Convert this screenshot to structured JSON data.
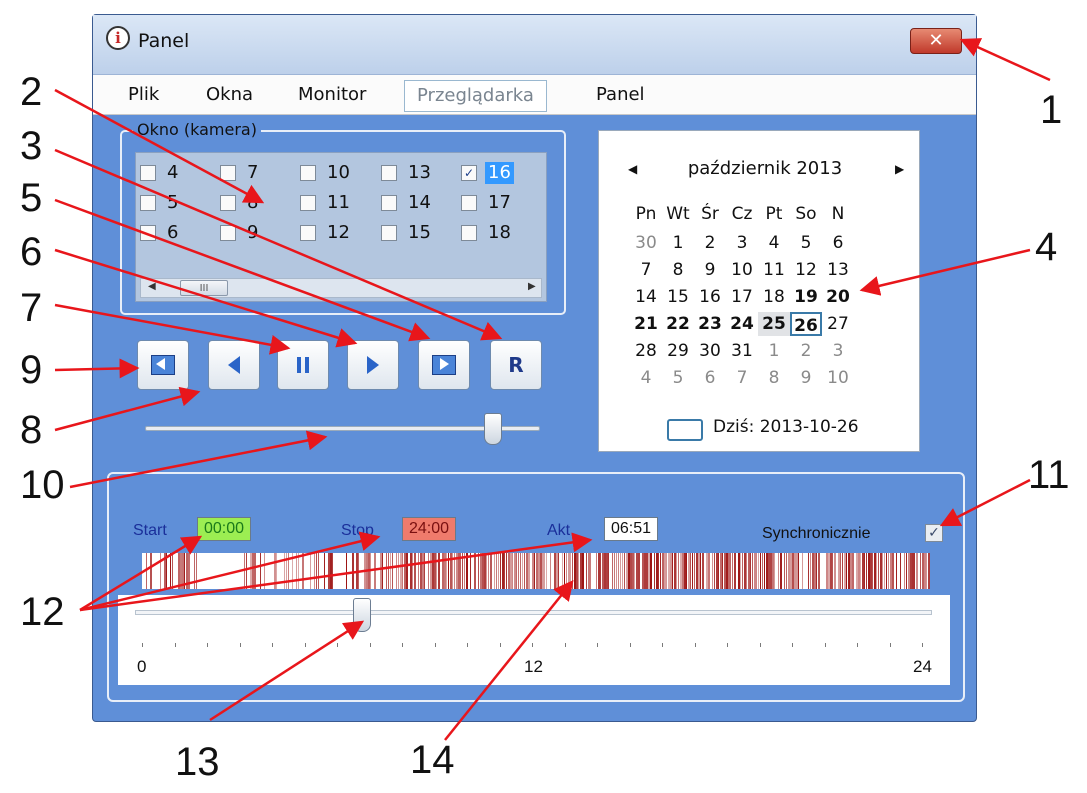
{
  "window": {
    "title": "Panel",
    "close_glyph": "✕"
  },
  "menu": [
    "Plik",
    "Okna",
    "Monitor",
    "Przeglądarka",
    "Panel"
  ],
  "camera_group": {
    "label": "Okno (kamera)",
    "items": [
      {
        "num": "4",
        "checked": false
      },
      {
        "num": "5",
        "checked": false
      },
      {
        "num": "6",
        "checked": false
      },
      {
        "num": "7",
        "checked": false
      },
      {
        "num": "8",
        "checked": false
      },
      {
        "num": "9",
        "checked": false
      },
      {
        "num": "10",
        "checked": false
      },
      {
        "num": "11",
        "checked": false
      },
      {
        "num": "12",
        "checked": false
      },
      {
        "num": "13",
        "checked": false
      },
      {
        "num": "14",
        "checked": false
      },
      {
        "num": "15",
        "checked": false
      },
      {
        "num": "16",
        "checked": true,
        "selected": true
      },
      {
        "num": "17",
        "checked": false
      },
      {
        "num": "18",
        "checked": false
      }
    ],
    "scroll_left": "◀",
    "scroll_right": "▶",
    "scroll_thumb": "III"
  },
  "playback": {
    "reset_label": "R",
    "speed_level": 0.88
  },
  "calendar": {
    "month_label": "październik 2013",
    "prev": "◀",
    "next": "▶",
    "weekdays": [
      "Pn",
      "Wt",
      "Śr",
      "Cz",
      "Pt",
      "So",
      "N"
    ],
    "weeks": [
      [
        {
          "d": "30",
          "o": true
        },
        {
          "d": "1"
        },
        {
          "d": "2"
        },
        {
          "d": "3"
        },
        {
          "d": "4"
        },
        {
          "d": "5"
        },
        {
          "d": "6"
        }
      ],
      [
        {
          "d": "7"
        },
        {
          "d": "8"
        },
        {
          "d": "9"
        },
        {
          "d": "10"
        },
        {
          "d": "11"
        },
        {
          "d": "12"
        },
        {
          "d": "13"
        }
      ],
      [
        {
          "d": "14"
        },
        {
          "d": "15"
        },
        {
          "d": "16"
        },
        {
          "d": "17"
        },
        {
          "d": "18"
        },
        {
          "d": "19",
          "b": true
        },
        {
          "d": "20",
          "b": true
        }
      ],
      [
        {
          "d": "21",
          "b": true
        },
        {
          "d": "22",
          "b": true
        },
        {
          "d": "23",
          "b": true
        },
        {
          "d": "24",
          "b": true
        },
        {
          "d": "25",
          "b": true,
          "h": true
        },
        {
          "d": "26",
          "b": true,
          "t": true
        },
        {
          "d": "27"
        }
      ],
      [
        {
          "d": "28"
        },
        {
          "d": "29"
        },
        {
          "d": "30"
        },
        {
          "d": "31"
        },
        {
          "d": "1",
          "o": true
        },
        {
          "d": "2",
          "o": true
        },
        {
          "d": "3",
          "o": true
        }
      ],
      [
        {
          "d": "4",
          "o": true
        },
        {
          "d": "5",
          "o": true
        },
        {
          "d": "6",
          "o": true
        },
        {
          "d": "7",
          "o": true
        },
        {
          "d": "8",
          "o": true
        },
        {
          "d": "9",
          "o": true
        },
        {
          "d": "10",
          "o": true
        }
      ]
    ],
    "today_label": "Dziś: 2013-10-26"
  },
  "time": {
    "start_label": "Start",
    "start_value": "00:00",
    "stop_label": "Stop",
    "stop_value": "24:00",
    "akt_label": "Akt",
    "akt_value": "06:51",
    "sync_label": "Synchronicznie",
    "sync_checked": true,
    "check_glyph": "✓"
  },
  "timeline": {
    "min_label": "0",
    "mid_label": "12",
    "max_label": "24",
    "position_hours": 6.85
  },
  "callouts": [
    "1",
    "2",
    "3",
    "4",
    "5",
    "6",
    "7",
    "8",
    "9",
    "10",
    "11",
    "12",
    "13",
    "14"
  ],
  "colors": {
    "window_bg": "#5f8fd8",
    "activity_red": "#9b1010",
    "start_green": "#9cee52",
    "stop_red": "#ef7b6c"
  }
}
